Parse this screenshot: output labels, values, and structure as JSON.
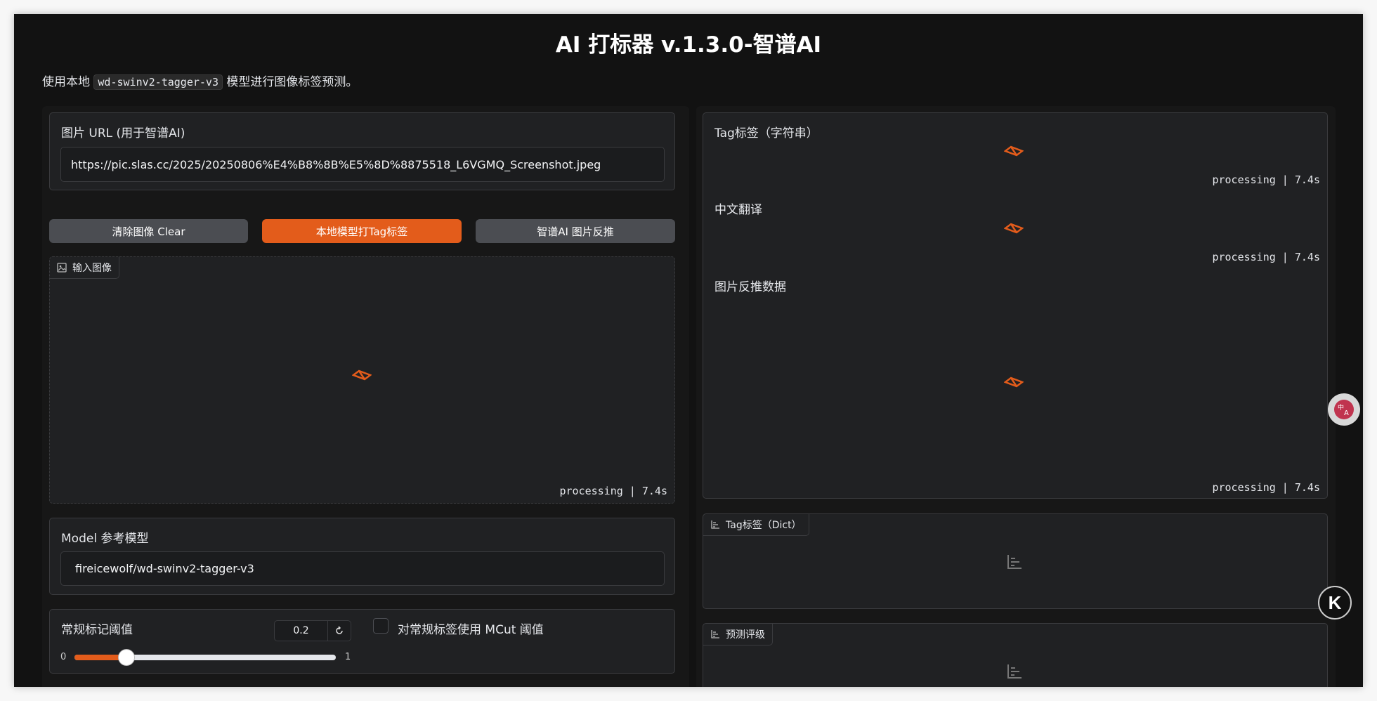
{
  "header": {
    "title": "AI 打标器 v.1.3.0-智谱AI",
    "desc_prefix": "使用本地",
    "desc_code": "wd-swinv2-tagger-v3",
    "desc_suffix": "模型进行图像标签预测。"
  },
  "left": {
    "url_label": "图片 URL (用于智谱AI)",
    "url_value": "https://pic.slas.cc/2025/20250806%E4%B8%8B%E5%8D%8875518_L6VGMQ_Screenshot.jpeg",
    "buttons": {
      "clear": "清除图像 Clear",
      "local_tag": "本地模型打Tag标签",
      "zhipu": "智谱AI 图片反推"
    },
    "input_image_label": "输入图像",
    "input_image_status": "processing | 7.4s",
    "model_label": "Model 参考模型",
    "model_value": "fireicewolf/wd-swinv2-tagger-v3",
    "threshold_label": "常规标记阈值",
    "threshold_value": "0.2",
    "threshold_min": "0",
    "threshold_max": "1",
    "threshold_fraction": 0.2,
    "mcut_label": "对常规标签使用 MCut 阈值"
  },
  "right": {
    "tag_string_label": "Tag标签（字符串）",
    "tag_string_status": "processing | 7.4s",
    "translation_label": "中文翻译",
    "translation_status": "processing | 7.4s",
    "reverse_label": "图片反推数据",
    "reverse_status": "processing | 7.4s",
    "tag_dict_label": "Tag标签（Dict）",
    "rating_label": "预测评级"
  },
  "colors": {
    "accent": "#e35c1b",
    "background": "#121212",
    "panel": "#202123"
  },
  "icons": [
    "image-icon",
    "loader-icon",
    "chart-icon",
    "reset-icon",
    "translate-icon",
    "k-logo-icon"
  ]
}
